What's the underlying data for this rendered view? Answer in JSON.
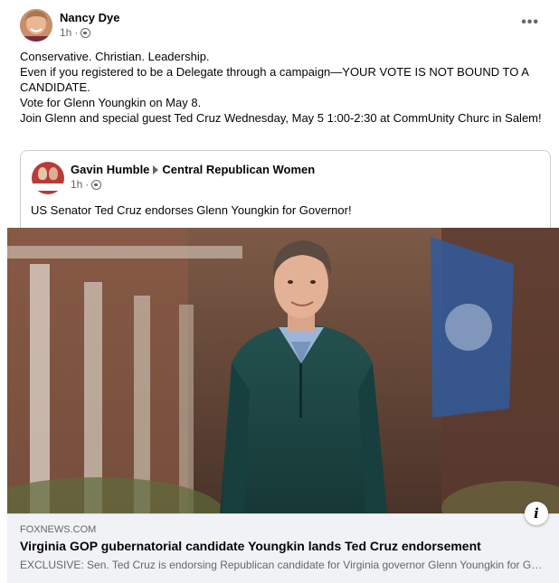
{
  "post": {
    "author": "Nancy Dye",
    "time": "1h",
    "meta_sep": "·",
    "more_icon": "more-horizontal-icon",
    "more_label": "•••",
    "lines": [
      "Conservative. Christian. Leadership.",
      "Even if you registered to be a Delegate through a campaign—YOUR VOTE IS NOT BOUND TO A CANDIDATE.",
      "Vote for Glenn Youngkin on May 8.",
      "Join Glenn and special guest Ted Cruz Wednesday, May 5 1:00-2:30 at CommUnity Churc in Salem!"
    ]
  },
  "shared": {
    "author": "Gavin Humble",
    "group": "Central Republican Women",
    "time": "1h",
    "meta_sep": "·",
    "text": "US Senator Ted Cruz endorses Glenn Youngkin for Governor!"
  },
  "link": {
    "domain": "FOXNEWS.COM",
    "title": "Virginia GOP gubernatorial candidate Youngkin lands Ted Cruz endorsement",
    "description": "EXCLUSIVE: Sen. Ted Cruz is endorsing Republican candidate for Virginia governor Glenn Youngkin for Governor.",
    "info_label": "i"
  },
  "colors": {
    "text_primary": "#050505",
    "text_secondary": "#65676b",
    "preview_bg": "#f0f2f5",
    "border": "#ccd0d5"
  }
}
